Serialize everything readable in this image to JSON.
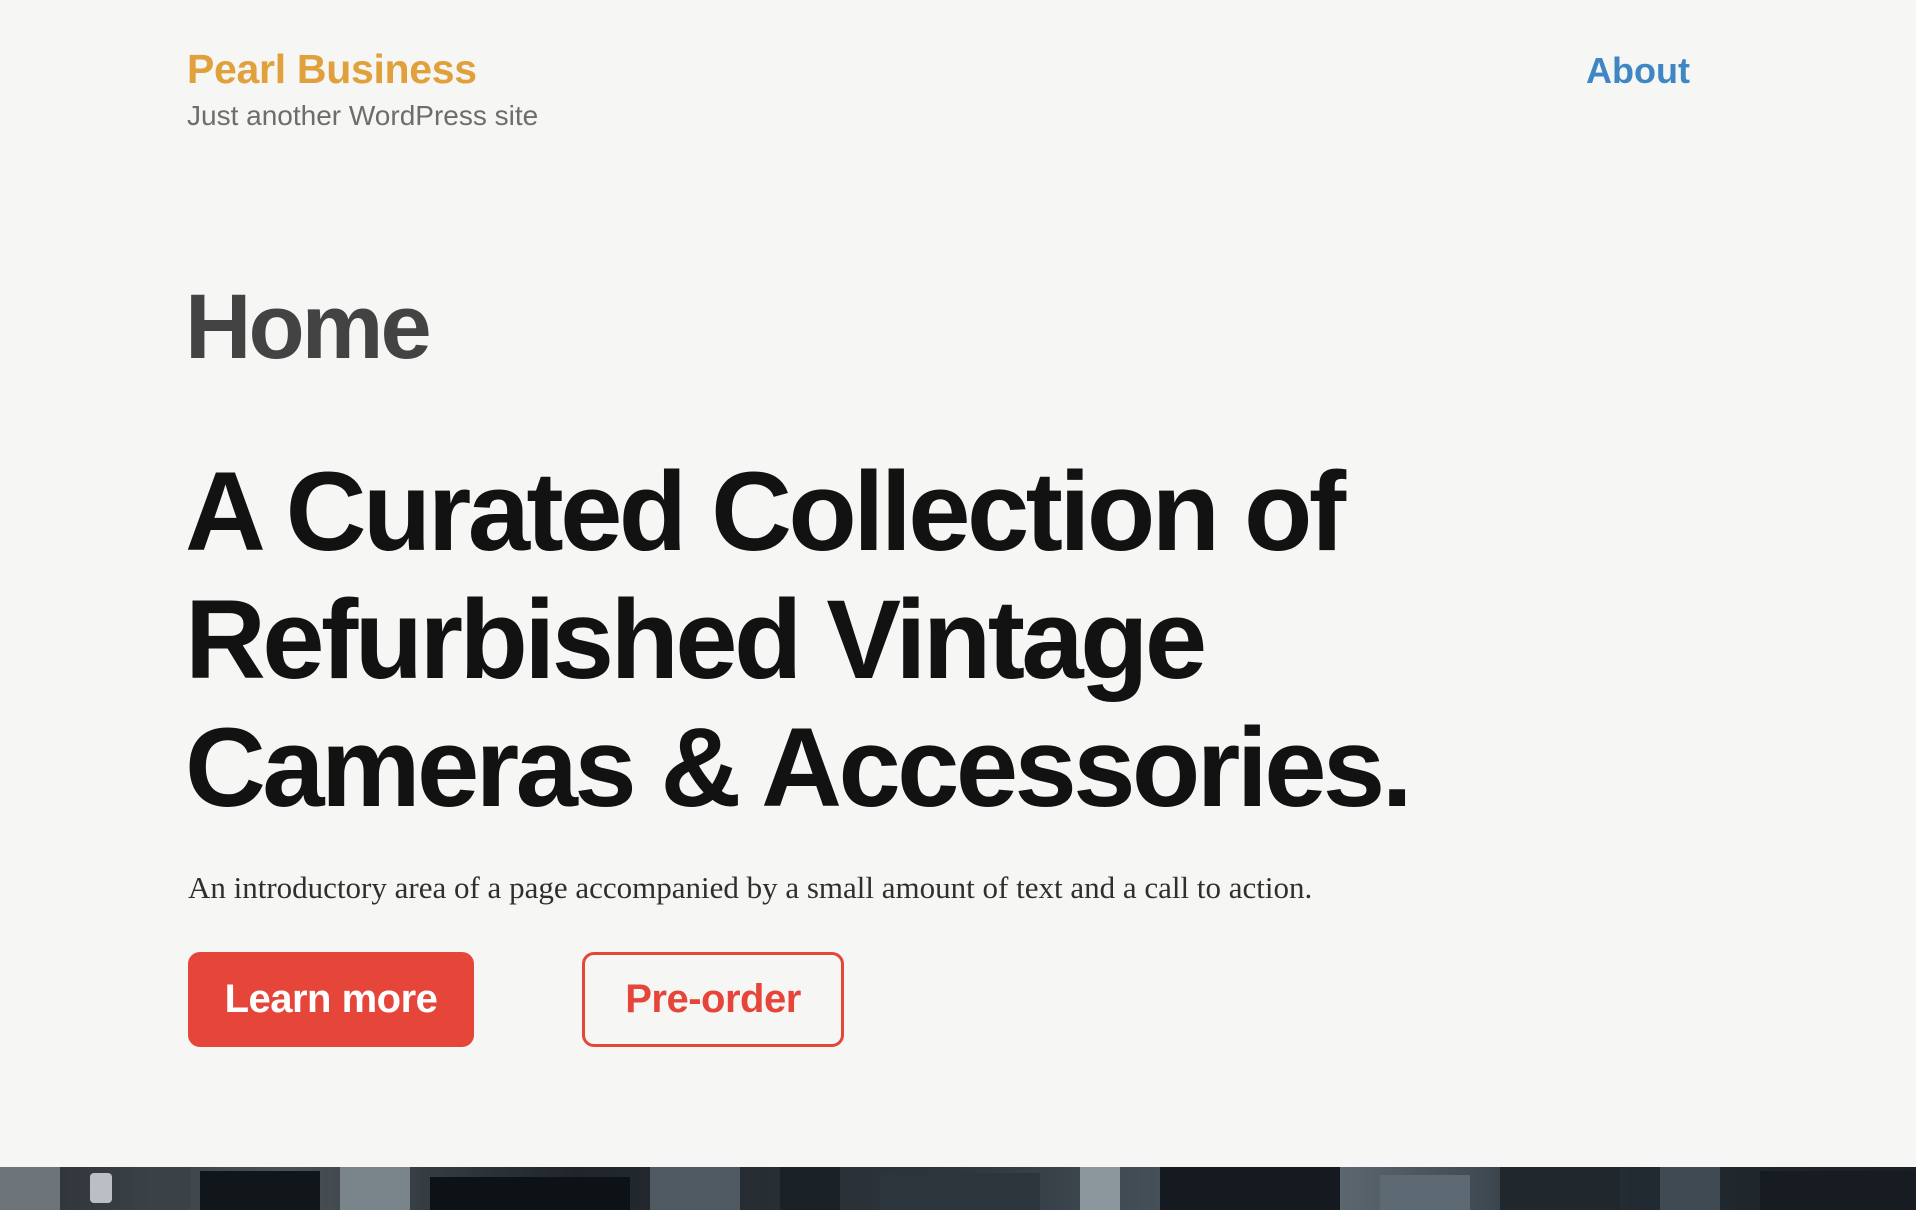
{
  "site": {
    "title": "Pearl Business",
    "tagline": "Just another WordPress site"
  },
  "nav": {
    "items": [
      {
        "label": "About"
      }
    ]
  },
  "page": {
    "title": "Home"
  },
  "hero": {
    "heading_lines": [
      "A Curated Collection of",
      "Refurbished Vintage",
      "Cameras & Accessories."
    ],
    "intro": "An introductory area of a page accompanied by a small amount of text and a call to action.",
    "buttons": {
      "primary_label": "Learn more",
      "secondary_label": "Pre-order"
    },
    "image": {
      "icon": "camera-photo-image"
    }
  },
  "colors": {
    "background": "#f6f6f4",
    "site_title": "#e0a13c",
    "nav_link": "#3e86c4",
    "accent": "#e6453a",
    "heading": "#121212",
    "page_title": "#434343"
  }
}
